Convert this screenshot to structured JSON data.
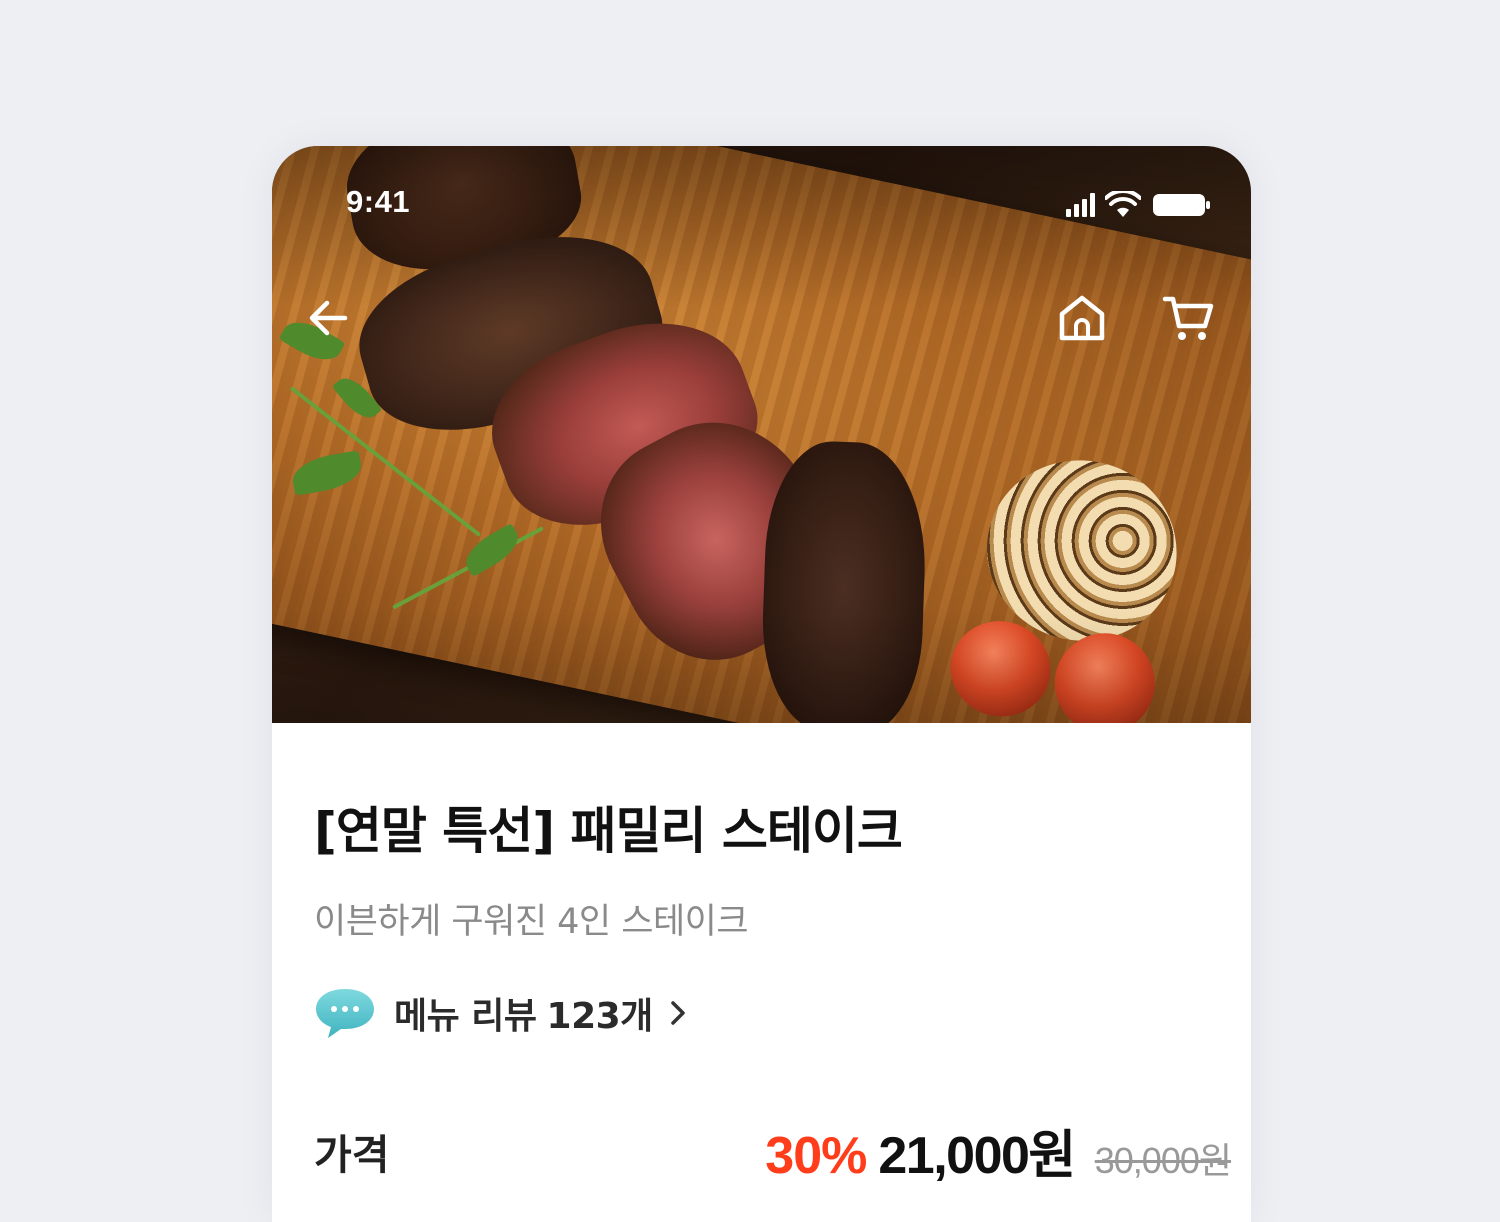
{
  "status_bar": {
    "time": "9:41"
  },
  "nav": {
    "back_icon": "arrow-left-icon",
    "home_icon": "home-icon",
    "cart_icon": "cart-icon"
  },
  "product": {
    "title": "[연말 특선] 패밀리 스테이크",
    "subtitle": "이븐하게 구워진 4인 스테이크",
    "review": {
      "icon": "chat-bubble-icon",
      "label": "메뉴 리뷰",
      "count": "123개",
      "chevron": "chevron-right-icon"
    },
    "price": {
      "label": "가격",
      "discount": "30%",
      "sale_price": "21,000원",
      "original_price": "30,000원"
    }
  },
  "colors": {
    "background": "#eeeff3",
    "discount": "#ff3d1a",
    "title": "#111111",
    "subtitle": "#8a8a8a",
    "review_icon": "#58c6cf"
  }
}
